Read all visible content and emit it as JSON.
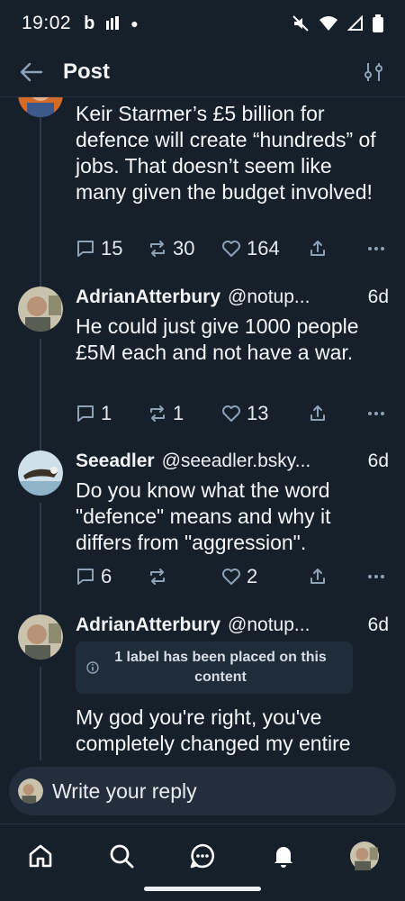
{
  "status": {
    "time": "19:02"
  },
  "header": {
    "title": "Post"
  },
  "posts": [
    {
      "text": "Keir Starmer’s £5 billion for defence will create “hundreds” of jobs. That doesn’t seem like many given the budget involved!",
      "replies": "15",
      "reposts": "30",
      "likes": "164"
    },
    {
      "name": "AdrianAtterbury",
      "handle": "@notup...",
      "age": "6d",
      "text": "He could just give 1000 people £5M each and not have a war.",
      "replies": "1",
      "reposts": "1",
      "likes": "13"
    },
    {
      "name": "Seeadler",
      "handle": "@seeadler.bsky...",
      "age": "6d",
      "text": "Do you know what the word \"defence\" means and why it differs from \"aggression\".",
      "replies": "6",
      "reposts": "",
      "likes": "2"
    },
    {
      "name": "AdrianAtterbury",
      "handle": "@notup...",
      "age": "6d",
      "label": "1 label has been placed on this content",
      "text": "My god you're right, you've completely changed my entire weltanschauung, now"
    }
  ],
  "reply": {
    "placeholder": "Write your reply"
  },
  "colors": {
    "background": "#16202b",
    "muted_icon": "#8ea2b7",
    "accent_line": "#2c3a4b"
  }
}
